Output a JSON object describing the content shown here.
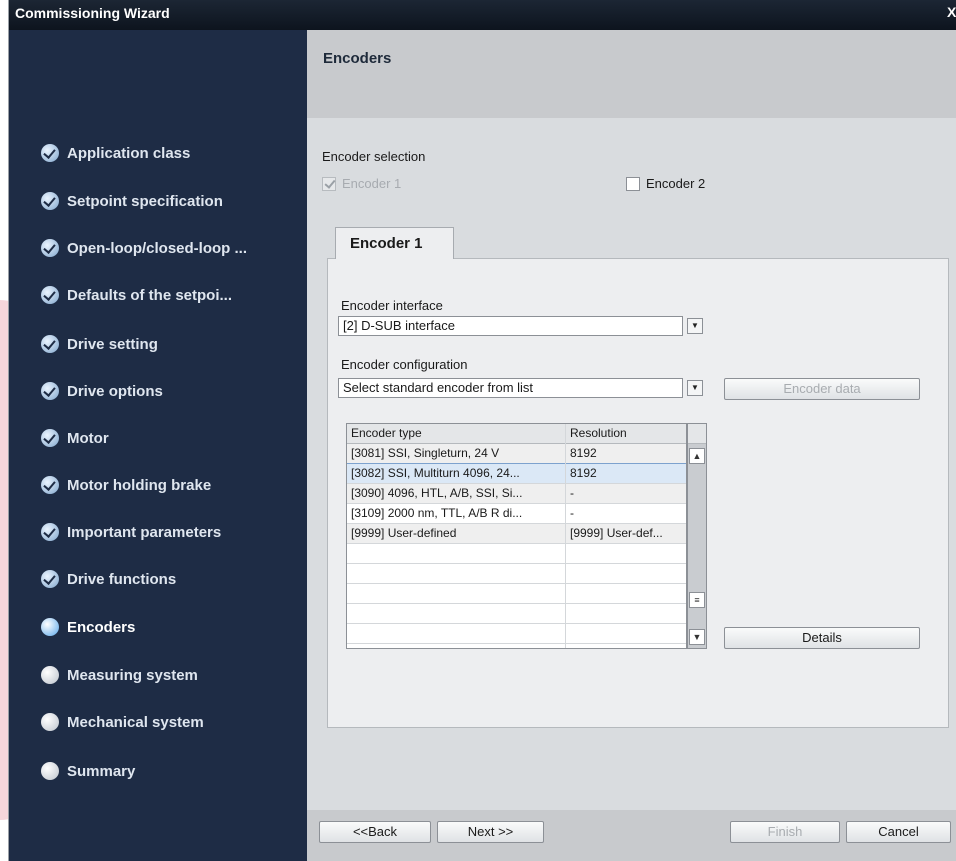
{
  "window": {
    "title": "Commissioning Wizard",
    "close_glyph": "X"
  },
  "sidebar": {
    "items": [
      {
        "label": "Application class",
        "state": "done"
      },
      {
        "label": "Setpoint specification",
        "state": "done"
      },
      {
        "label": "Open-loop/closed-loop ...",
        "state": "done"
      },
      {
        "label": "Defaults of the setpoi...",
        "state": "done"
      },
      {
        "label": "Drive setting",
        "state": "done"
      },
      {
        "label": "Drive options",
        "state": "done"
      },
      {
        "label": "Motor",
        "state": "done"
      },
      {
        "label": "Motor holding brake",
        "state": "done"
      },
      {
        "label": "Important parameters",
        "state": "done"
      },
      {
        "label": "Drive functions",
        "state": "done"
      },
      {
        "label": "Encoders",
        "state": "current"
      },
      {
        "label": "Measuring system",
        "state": "pending"
      },
      {
        "label": "Mechanical system",
        "state": "pending"
      },
      {
        "label": "Summary",
        "state": "pending"
      }
    ]
  },
  "header": {
    "title": "Encoders"
  },
  "encoder_selection": {
    "label": "Encoder selection",
    "encoder1": {
      "label": "Encoder 1",
      "checked": true,
      "disabled": true
    },
    "encoder2": {
      "label": "Encoder 2",
      "checked": false
    }
  },
  "tab": {
    "label": "Encoder 1"
  },
  "encoder_interface": {
    "label": "Encoder interface",
    "value": "[2] D-SUB interface"
  },
  "encoder_configuration": {
    "label": "Encoder configuration",
    "value": "Select standard encoder from list"
  },
  "buttons": {
    "encoder_data": "Encoder data",
    "details": "Details",
    "back": "<<Back",
    "next": "Next >>",
    "finish": "Finish",
    "cancel": "Cancel"
  },
  "table": {
    "columns": [
      "Encoder type",
      "Resolution"
    ],
    "rows": [
      [
        "[3081] SSI, Singleturn, 24 V",
        "8192"
      ],
      [
        "[3082] SSI, Multiturn 4096, 24...",
        "8192"
      ],
      [
        "[3090] 4096, HTL, A/B, SSI, Si...",
        "-"
      ],
      [
        "[3109] 2000 nm, TTL, A/B R di...",
        "-"
      ],
      [
        "[9999] User-defined",
        "[9999] User-def..."
      ]
    ],
    "selected_index": 1
  },
  "colors": {
    "sidebar_bg": "#1e2c45",
    "titlebar_bg": "#0d141e",
    "header_bg": "#c8cacd",
    "panel_bg": "#edeef0",
    "selection": "#dbe8f6"
  }
}
